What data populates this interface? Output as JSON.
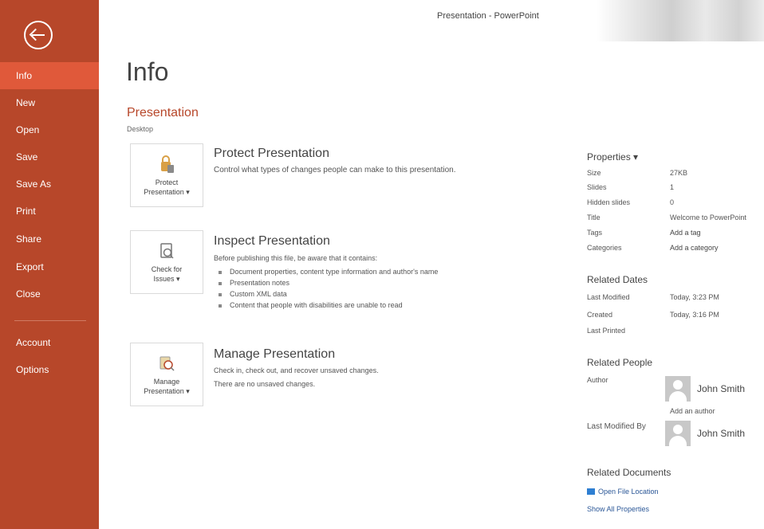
{
  "window": {
    "title": "Presentation - PowerPoint"
  },
  "nav": {
    "back_icon": "back-arrow-circle-icon",
    "items": [
      {
        "label": "Info",
        "active": true
      },
      {
        "label": "New"
      },
      {
        "label": "Open"
      },
      {
        "label": "Save"
      },
      {
        "label": "Save As"
      },
      {
        "label": "Print"
      },
      {
        "label": "Share"
      },
      {
        "label": "Export"
      },
      {
        "label": "Close"
      },
      {
        "label": "Account"
      },
      {
        "label": "Options"
      }
    ]
  },
  "page": {
    "title": "Info",
    "doc_name": "Presentation",
    "doc_location": "Desktop"
  },
  "protect": {
    "tile_label": "Protect\nPresentation ▾",
    "title": "Protect Presentation",
    "desc": "Control what types of changes people can make to this presentation."
  },
  "inspect": {
    "tile_label": "Check for\nIssues ▾",
    "title": "Inspect Presentation",
    "desc": "Before publishing this file, be aware that it contains:",
    "bullets": [
      "Document properties, content type information and author's name",
      "Presentation notes",
      "Custom XML data",
      "Content that people with disabilities are unable to read"
    ]
  },
  "manage": {
    "tile_label": "Manage\nPresentation ▾",
    "title": "Manage Presentation",
    "desc": "Check in, check out, and recover unsaved changes.",
    "status": "There are no unsaved changes."
  },
  "properties": {
    "title": "Properties ▾",
    "rows": [
      {
        "key": "Size",
        "value": "27KB"
      },
      {
        "key": "Slides",
        "value": "1"
      },
      {
        "key": "Hidden slides",
        "value": "0"
      },
      {
        "key": "Title",
        "value": "Welcome to PowerPoint"
      },
      {
        "key": "Tags",
        "value": "Add a tag"
      },
      {
        "key": "Categories",
        "value": "Add a category"
      }
    ]
  },
  "related_dates": {
    "title": "Related Dates",
    "rows": [
      {
        "key": "Last Modified",
        "value": "Today, 3:23 PM"
      },
      {
        "key": "Created",
        "value": "Today, 3:16 PM"
      },
      {
        "key": "Last Printed",
        "value": ""
      }
    ]
  },
  "related_people": {
    "title": "Related People",
    "author_label": "Author",
    "author_name": "John Smith",
    "add_author": "Add an author",
    "modified_label": "Last Modified By",
    "modified_name": "John Smith"
  },
  "related_documents": {
    "title": "Related Documents",
    "open_location": "Open File Location",
    "show_all": "Show All Properties"
  },
  "colors": {
    "accent": "#b7472a",
    "nav_active": "#e0593a"
  }
}
